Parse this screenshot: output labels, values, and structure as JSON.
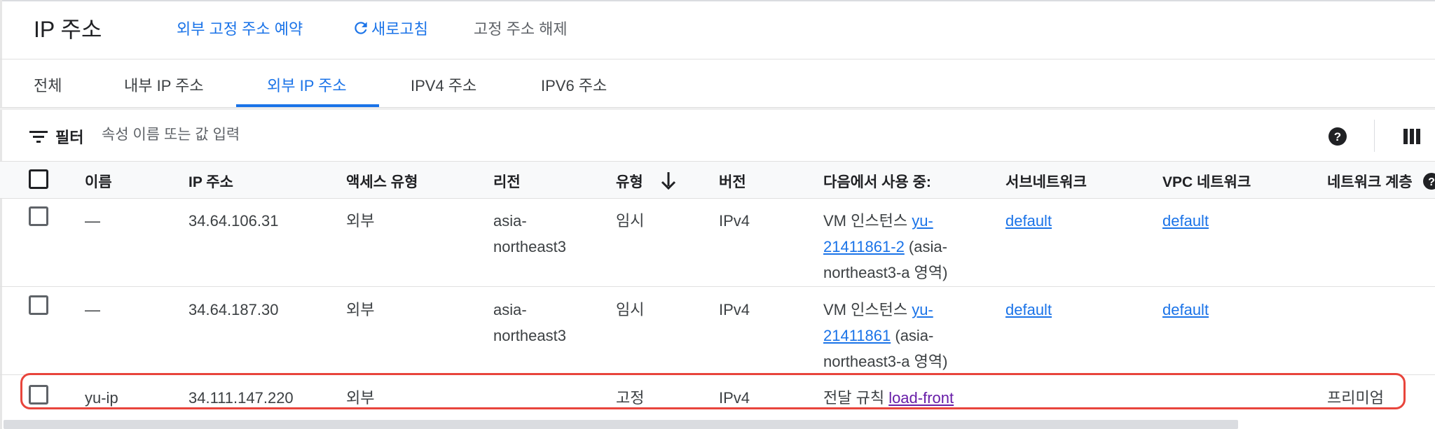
{
  "header": {
    "title": "IP 주소",
    "reserve_label": "외부 고정 주소 예약",
    "refresh_label": "새로고침",
    "release_label": "고정 주소 해제"
  },
  "tabs": [
    {
      "label": "전체"
    },
    {
      "label": "내부 IP 주소"
    },
    {
      "label": "외부 IP 주소"
    },
    {
      "label": "IPV4 주소"
    },
    {
      "label": "IPV6 주소"
    }
  ],
  "active_tab": "외부 IP 주소",
  "filter": {
    "label": "필터",
    "placeholder": "속성 이름 또는 값 입력"
  },
  "columns": {
    "name": "이름",
    "ip": "IP 주소",
    "access": "액세스 유형",
    "region": "리전",
    "type": "유형",
    "version": "버전",
    "used_by": "다음에서 사용 중:",
    "subnet": "서브네트워크",
    "vpc": "VPC 네트워크",
    "tier": "네트워크 계층"
  },
  "sort": {
    "column": "유형",
    "direction": "descending",
    "icon": "arrow-down-icon"
  },
  "rows": [
    {
      "name": "—",
      "ip": "34.64.106.31",
      "access": "외부",
      "region_l1": "asia-",
      "region_l2": "northeast3",
      "type": "임시",
      "version": "IPv4",
      "used_prefix": "VM 인스턴스 ",
      "used_link_l1": "yu-",
      "used_link_l2": "21411861-2",
      "used_suffix_l2": " (asia-",
      "used_l3": "northeast3-a 영역)",
      "subnet": "default",
      "vpc": "default",
      "tier": ""
    },
    {
      "name": "—",
      "ip": "34.64.187.30",
      "access": "외부",
      "region_l1": "asia-",
      "region_l2": "northeast3",
      "type": "임시",
      "version": "IPv4",
      "used_prefix": "VM 인스턴스 ",
      "used_link_l1": "yu-",
      "used_link_l2": "21411861",
      "used_suffix_l2": " (asia-",
      "used_l3": "northeast3-a 영역)",
      "subnet": "default",
      "vpc": "default",
      "tier": ""
    },
    {
      "name": "yu-ip",
      "ip": "34.111.147.220",
      "access": "외부",
      "region_l1": "",
      "region_l2": "",
      "type": "고정",
      "version": "IPv4",
      "used_prefix": "전달 규칙 ",
      "used_link": "load-front",
      "subnet": "",
      "vpc": "",
      "tier": "프리미엄"
    }
  ],
  "colors": {
    "accent": "#1a73e8",
    "visited_link": "#681da8",
    "highlight": "#e8453c"
  }
}
